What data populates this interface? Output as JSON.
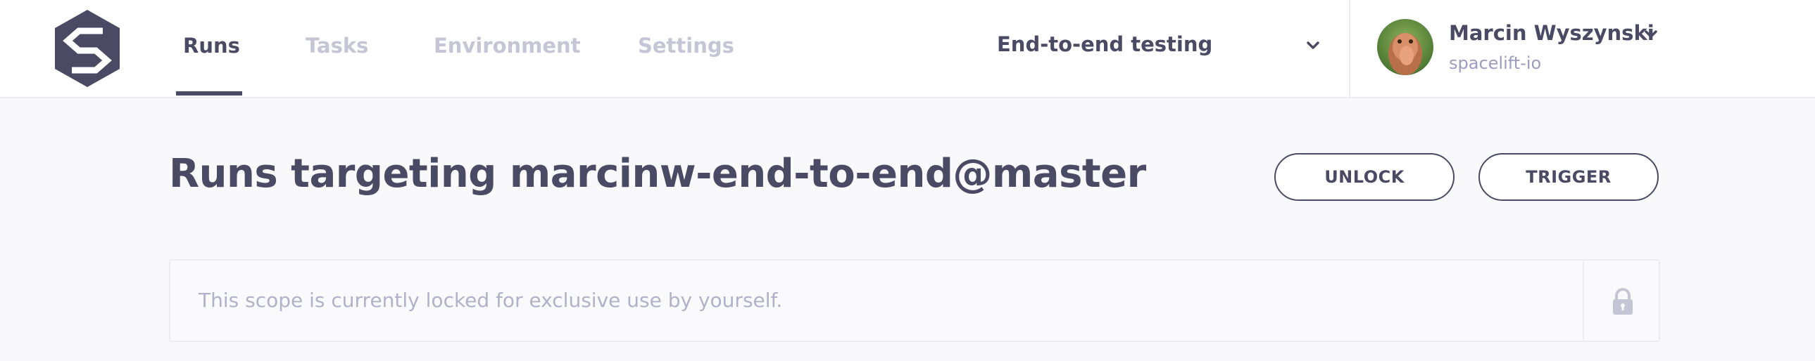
{
  "app": {
    "logo_icon": "spacelift-logo-icon"
  },
  "nav": {
    "tabs": [
      {
        "label": "Runs",
        "active": true
      },
      {
        "label": "Tasks",
        "active": false
      },
      {
        "label": "Environment",
        "active": false
      },
      {
        "label": "Settings",
        "active": false
      }
    ]
  },
  "environment_select": {
    "value": "End-to-end testing",
    "icon": "chevron-down-icon"
  },
  "user": {
    "name": "Marcin Wyszynski",
    "org": "spacelift-io",
    "avatar_icon": "avatar-photo"
  },
  "main": {
    "title": "Runs targeting marcinw-end-to-end@master",
    "buttons": {
      "unlock": "UNLOCK",
      "trigger": "TRIGGER"
    },
    "lock_notice": {
      "text": "This scope is currently locked for exclusive use by yourself.",
      "icon": "lock-icon"
    }
  },
  "colors": {
    "text_primary": "#4a4a64",
    "text_muted": "#c5c5d6",
    "subtext": "#9c9cbe",
    "background": "#f9f9fb",
    "border": "#ececf2"
  }
}
